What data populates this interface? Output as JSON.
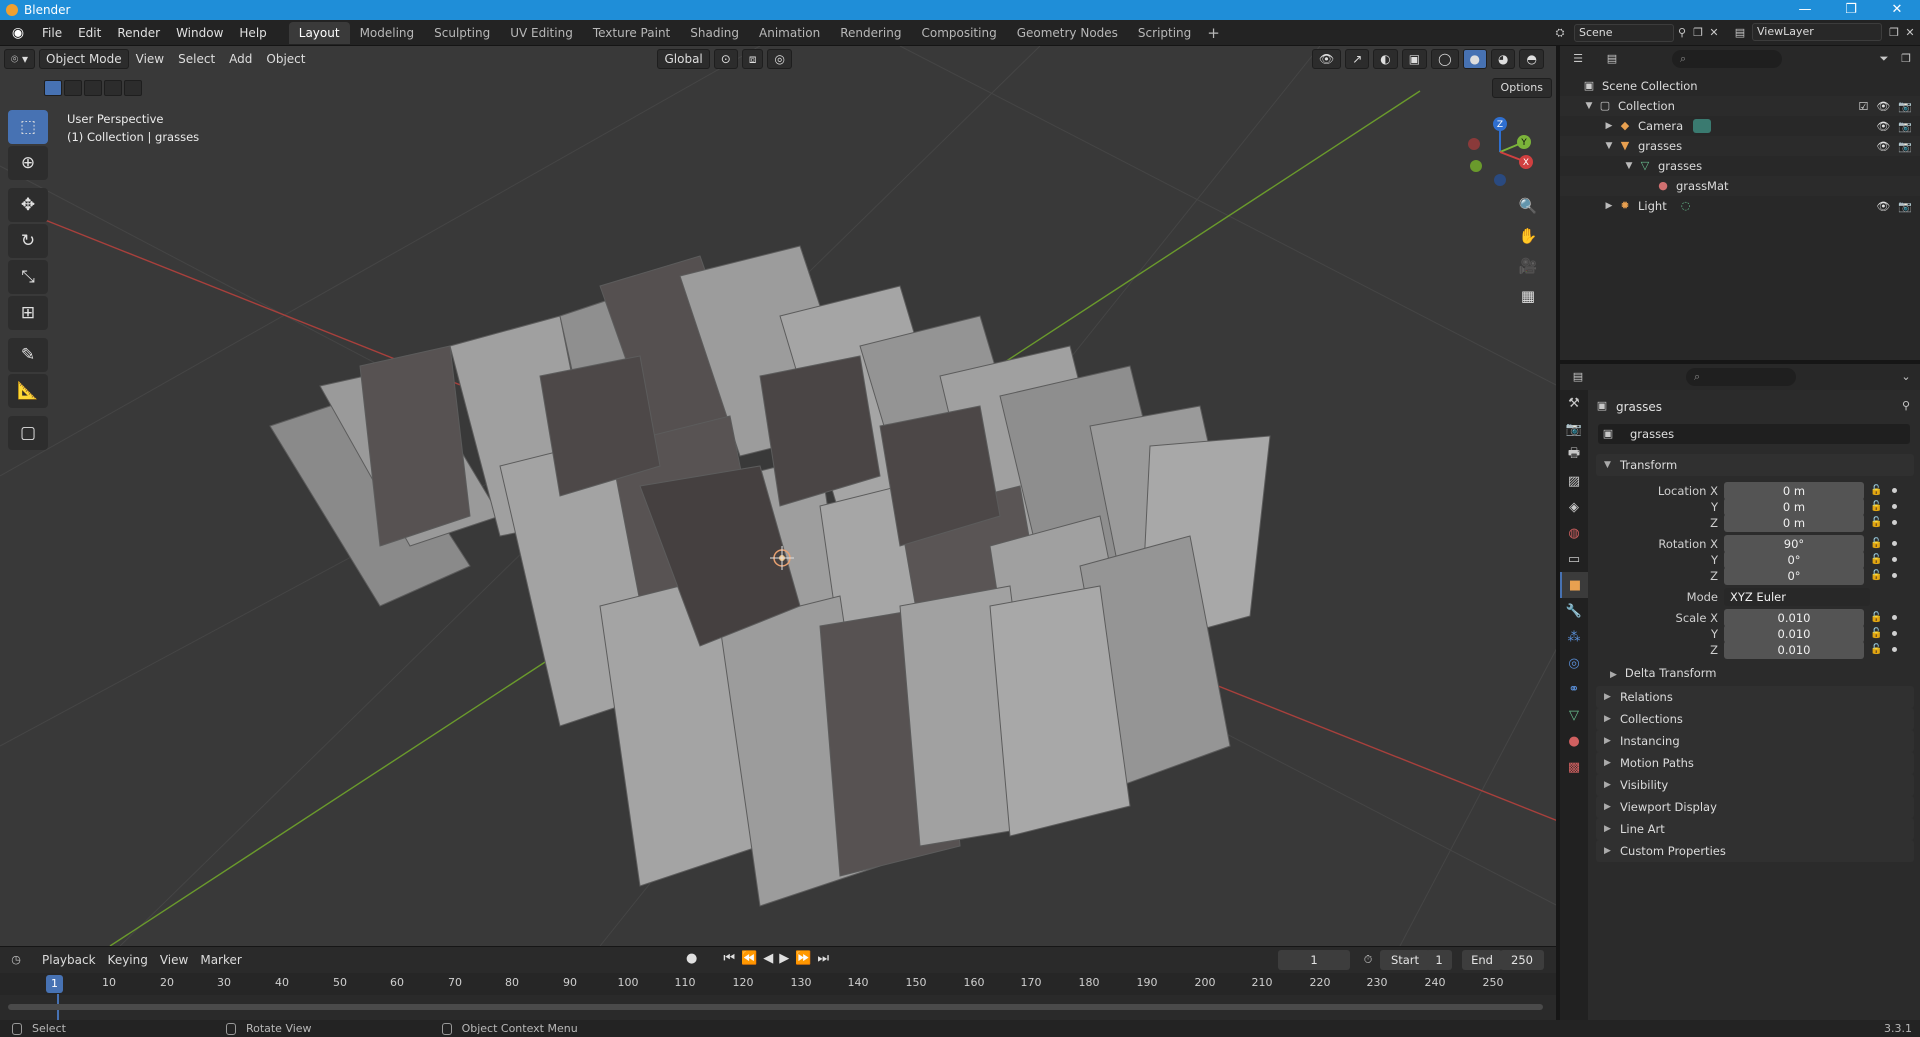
{
  "window": {
    "title": "Blender",
    "controls": [
      "—",
      "❐",
      "✕"
    ]
  },
  "menu": [
    "File",
    "Edit",
    "Render",
    "Window",
    "Help"
  ],
  "workspaces": [
    "Layout",
    "Modeling",
    "Sculpting",
    "UV Editing",
    "Texture Paint",
    "Shading",
    "Animation",
    "Rendering",
    "Compositing",
    "Geometry Nodes",
    "Scripting"
  ],
  "active_workspace": "Layout",
  "scene": {
    "name": "Scene",
    "view_layer": "ViewLayer"
  },
  "viewport": {
    "mode": "Object Mode",
    "menus": [
      "View",
      "Select",
      "Add",
      "Object"
    ],
    "orientation": "Global",
    "options_label": "Options",
    "info_line1": "User Perspective",
    "info_line2": "(1) Collection | grasses",
    "gizmo_axes": {
      "x": "X",
      "y": "Y",
      "z": "Z"
    }
  },
  "outliner": {
    "rows": [
      {
        "label": "Scene Collection",
        "icon": "scene-collection-icon"
      },
      {
        "label": "Collection",
        "icon": "collection-icon"
      },
      {
        "label": "Camera",
        "icon": "camera-icon"
      },
      {
        "label": "grasses",
        "icon": "mesh-object-icon"
      },
      {
        "label": "grasses",
        "icon": "mesh-data-icon"
      },
      {
        "label": "grassMat",
        "icon": "material-icon"
      },
      {
        "label": "Light",
        "icon": "light-icon"
      }
    ]
  },
  "properties": {
    "object_name": "grasses",
    "name_field": "grasses",
    "transform": {
      "title": "Transform",
      "location_label": "Location X",
      "location": [
        "0 m",
        "0 m",
        "0 m"
      ],
      "rotation_label": "Rotation X",
      "rotation": [
        "90°",
        "0°",
        "0°"
      ],
      "mode_label": "Mode",
      "mode": "XYZ Euler",
      "scale_label": "Scale X",
      "scale": [
        "0.010",
        "0.010",
        "0.010"
      ],
      "y_label": "Y",
      "z_label": "Z",
      "delta": "Delta Transform"
    },
    "panels": [
      "Relations",
      "Collections",
      "Instancing",
      "Motion Paths",
      "Visibility",
      "Viewport Display",
      "Line Art",
      "Custom Properties"
    ]
  },
  "timeline": {
    "menus": [
      "Playback",
      "Keying",
      "View",
      "Marker"
    ],
    "current_frame": "1",
    "start_label": "Start",
    "start": "1",
    "end_label": "End",
    "end": "250",
    "ruler": [
      "1",
      "10",
      "20",
      "30",
      "40",
      "50",
      "60",
      "70",
      "80",
      "90",
      "100",
      "110",
      "120",
      "130",
      "140",
      "150",
      "160",
      "170",
      "180",
      "190",
      "200",
      "210",
      "220",
      "230",
      "240",
      "250"
    ]
  },
  "statusbar": {
    "select": "Select",
    "rotate": "Rotate View",
    "context": "Object Context Menu",
    "version": "3.3.1"
  }
}
